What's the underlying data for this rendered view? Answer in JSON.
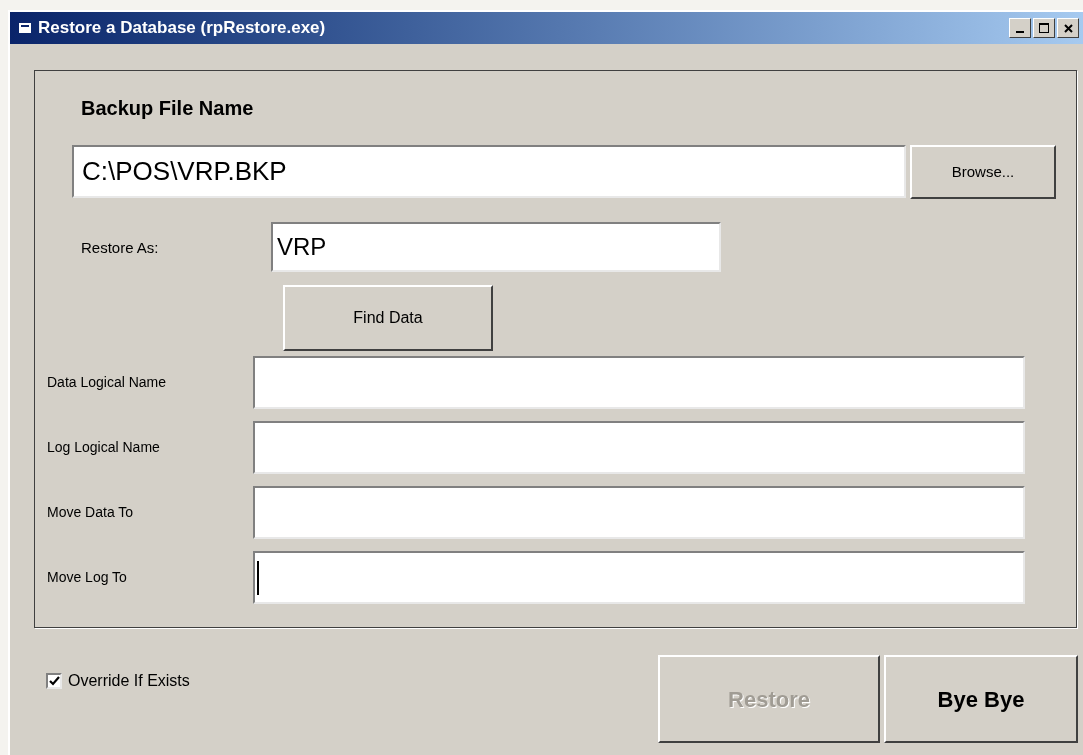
{
  "window": {
    "title": "Restore a Database (rpRestore.exe)"
  },
  "backup": {
    "heading": "Backup File Name",
    "value": "C:\\POS\\VRP.BKP",
    "browse": "Browse..."
  },
  "restore_as": {
    "label": "Restore As:",
    "value": "VRP"
  },
  "find_button": "Find Data",
  "fields": [
    {
      "label": "Data Logical Name",
      "focused": false
    },
    {
      "label": "Log Logical Name",
      "focused": false
    },
    {
      "label": "Move Data To",
      "focused": false
    },
    {
      "label": "Move Log To",
      "focused": true
    }
  ],
  "override": {
    "label": "Override If Exists",
    "checked": true
  },
  "buttons": [
    {
      "label": "Restore",
      "disabled": true
    },
    {
      "label": "Bye Bye",
      "disabled": false
    }
  ]
}
